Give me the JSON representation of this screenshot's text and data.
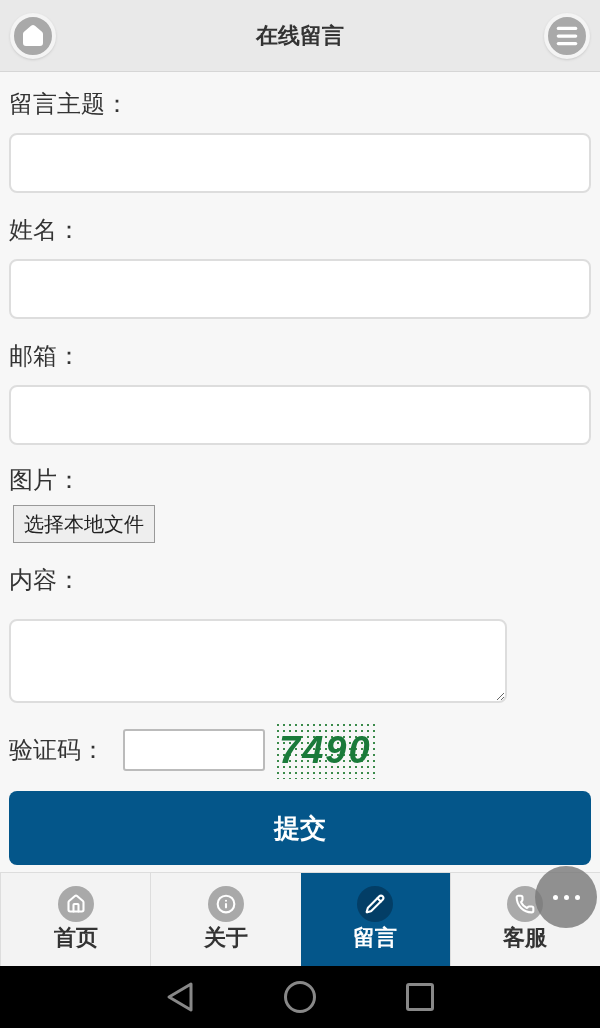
{
  "header": {
    "title": "在线留言"
  },
  "fields": [
    {
      "kind": "text",
      "label": "留言主题："
    },
    {
      "kind": "text",
      "label": "姓名："
    },
    {
      "kind": "text",
      "label": "邮箱："
    },
    {
      "kind": "file",
      "label": "图片：",
      "button": "选择本地文件"
    },
    {
      "kind": "textarea",
      "label": "内容："
    }
  ],
  "captcha": {
    "label": "验证码：",
    "code": "7490"
  },
  "submit": "提交",
  "tabs": [
    {
      "kind": "home",
      "label": "首页",
      "selected": false
    },
    {
      "kind": "info",
      "label": "关于",
      "selected": false
    },
    {
      "kind": "pencil",
      "label": "留言",
      "selected": true
    },
    {
      "kind": "phone",
      "label": "客服",
      "selected": false
    }
  ]
}
